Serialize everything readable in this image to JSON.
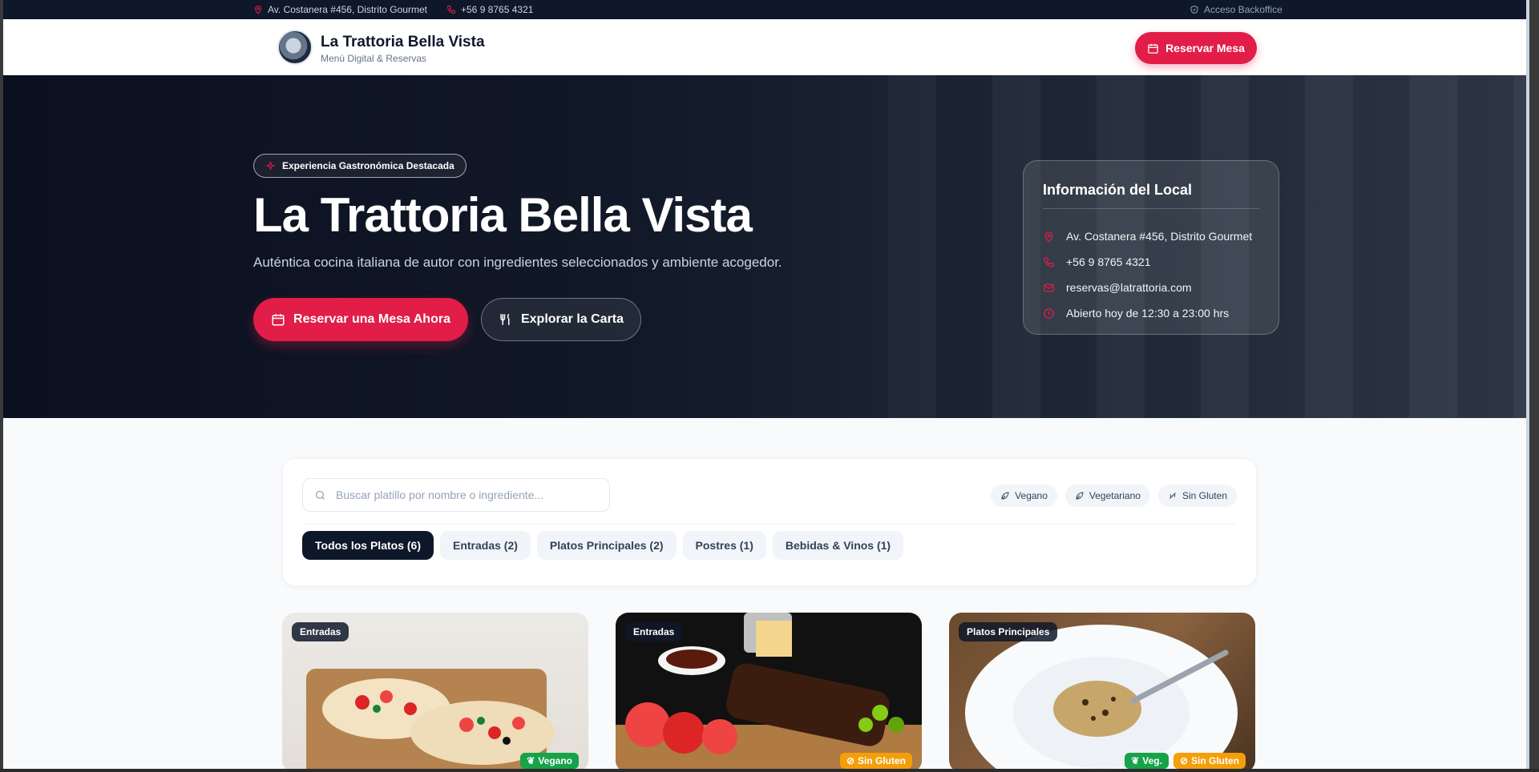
{
  "topbar": {
    "address": "Av. Costanera #456, Distrito Gourmet",
    "phone": "+56 9 8765 4321",
    "backoffice": "Acceso Backoffice"
  },
  "header": {
    "title": "La Trattoria Bella Vista",
    "subtitle": "Menú Digital & Reservas",
    "reserve_button": "Reservar Mesa"
  },
  "hero": {
    "badge": "Experiencia Gastronómica Destacada",
    "title": "La Trattoria Bella Vista",
    "subtitle": "Auténtica cocina italiana de autor con ingredientes seleccionados y ambiente acogedor.",
    "primary_button": "Reservar una Mesa Ahora",
    "secondary_button": "Explorar la Carta"
  },
  "info": {
    "title": "Información del Local",
    "address": "Av. Costanera #456, Distrito Gourmet",
    "phone": "+56 9 8765 4321",
    "email": "reservas@latrattoria.com",
    "hours": "Abierto hoy de 12:30 a 23:00 hrs"
  },
  "filters": {
    "search_placeholder": "Buscar platillo por nombre o ingrediente...",
    "diet_chips": [
      "Vegano",
      "Vegetariano",
      "Sin Gluten"
    ],
    "tabs": [
      "Todos los Platos (6)",
      "Entradas (2)",
      "Platos Principales (2)",
      "Postres (1)",
      "Bebidas & Vinos (1)"
    ],
    "active_tab": 0
  },
  "dishes": [
    {
      "category": "Entradas",
      "tags": [
        "Vegano"
      ]
    },
    {
      "category": "Entradas",
      "tags": [
        "Sin Gluten"
      ]
    },
    {
      "category": "Platos Principales",
      "tags": [
        "Veg.",
        "Sin Gluten"
      ]
    }
  ],
  "colors": {
    "accent": "#e11d48",
    "dark": "#0f172a",
    "tag_green": "#16a34a",
    "tag_amber": "#f59e0b"
  }
}
